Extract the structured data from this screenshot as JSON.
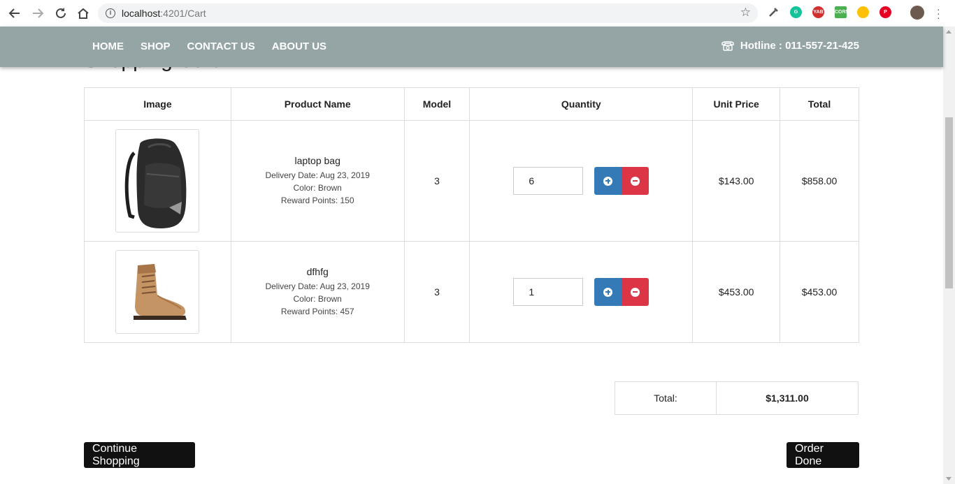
{
  "browser": {
    "url_host": "localhost",
    "url_path": ":4201/Cart"
  },
  "nav": {
    "items": [
      "HOME",
      "SHOP",
      "CONTACT US",
      "ABOUT US"
    ],
    "hotline": "Hotline : 011-557-21-425"
  },
  "page": {
    "heading_partial": "Shopping Cart"
  },
  "cart": {
    "headers": [
      "Image",
      "Product Name",
      "Model",
      "Quantity",
      "Unit Price",
      "Total"
    ],
    "rows": [
      {
        "image": "backpack-image",
        "name": "laptop bag",
        "delivery": "Delivery Date: Aug 23, 2019",
        "color": "Color: Brown",
        "reward": "Reward Points: 150",
        "model": "3",
        "quantity": "6",
        "unit_price": "$143.00",
        "total": "$858.00"
      },
      {
        "image": "boot-image",
        "name": "dfhfg",
        "delivery": "Delivery Date: Aug 23, 2019",
        "color": "Color: Brown",
        "reward": "Reward Points: 457",
        "model": "3",
        "quantity": "1",
        "unit_price": "$453.00",
        "total": "$453.00"
      }
    ]
  },
  "summary": {
    "label": "Total:",
    "value": "$1,311.00"
  },
  "actions": {
    "continue": "Continue Shopping",
    "order": "Order Done"
  },
  "colors": {
    "header": "#95a5a6",
    "plus": "#337ab7",
    "minus": "#dc3545",
    "button": "#111111"
  }
}
